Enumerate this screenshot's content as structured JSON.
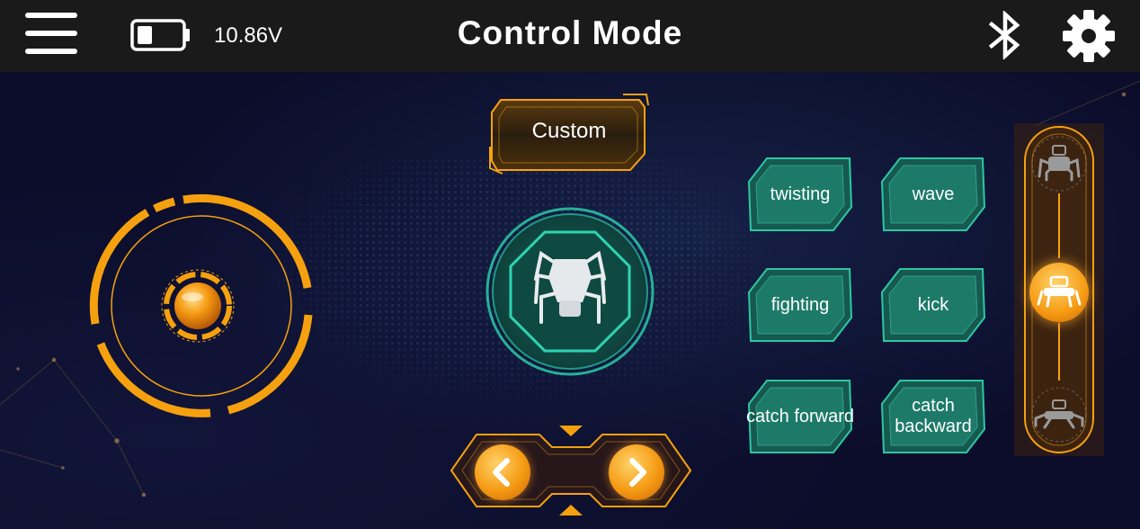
{
  "topbar": {
    "title": "Control Mode",
    "battery_voltage": "10.86V",
    "battery_level": 0.35,
    "icons": [
      "menu-icon",
      "battery-icon",
      "bluetooth-icon",
      "gear-icon"
    ]
  },
  "controls": {
    "custom_label": "Custom",
    "center_icon": "spider-robot-icon",
    "nav_prev_icon": "chevron-left-icon",
    "nav_next_icon": "chevron-right-icon"
  },
  "actions": [
    {
      "label": "twisting"
    },
    {
      "label": "wave"
    },
    {
      "label": "fighting"
    },
    {
      "label": "kick"
    },
    {
      "label": "catch forward"
    },
    {
      "label": "catch backward"
    }
  ],
  "height_modes": {
    "selected": "middle",
    "items": [
      "high-stance-icon",
      "middle-stance-icon",
      "low-stance-icon"
    ]
  },
  "colors": {
    "accent_orange": "#f5a10f",
    "action_teal": "#1f8f7a",
    "topbar": "#1a1a1a",
    "background": "#0c0d2b"
  }
}
